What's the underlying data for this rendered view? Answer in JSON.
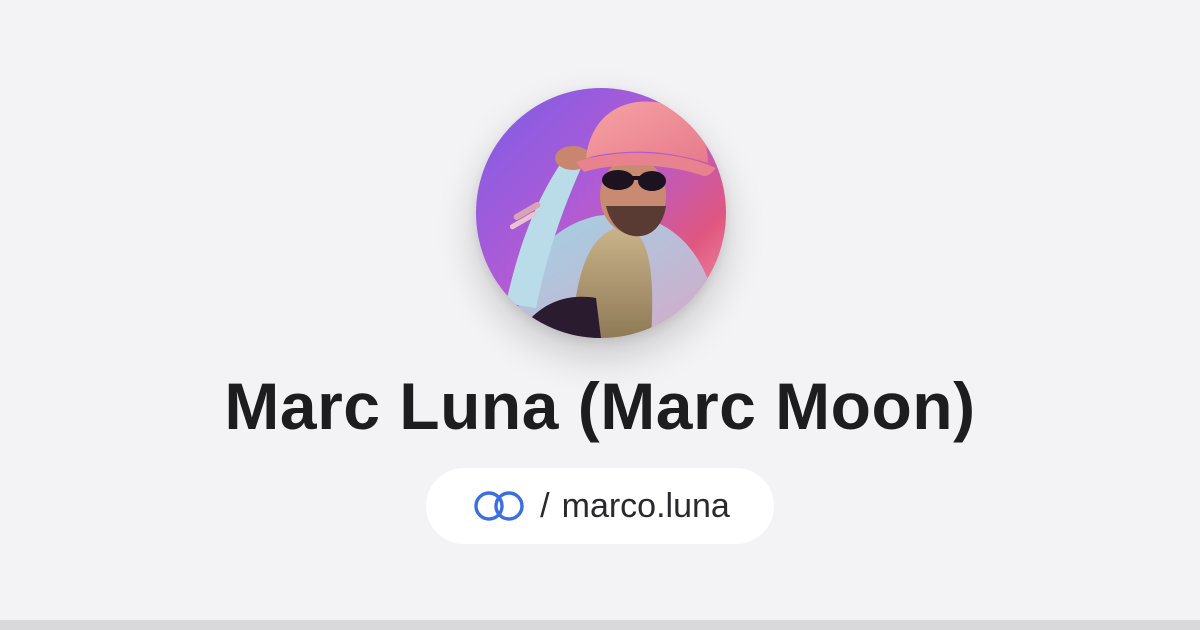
{
  "profile": {
    "display_name": "Marc Luna (Marc Moon)",
    "separator": "/",
    "handle": "marco.luna",
    "link_icon": "linked-rings-icon",
    "avatar_icon": "profile-photo",
    "colors": {
      "background": "#f3f3f5",
      "name": "#1d1d1f",
      "accent": "#3b6fe0",
      "pill": "#ffffff",
      "bottom_bar": "#d9d9db"
    }
  }
}
